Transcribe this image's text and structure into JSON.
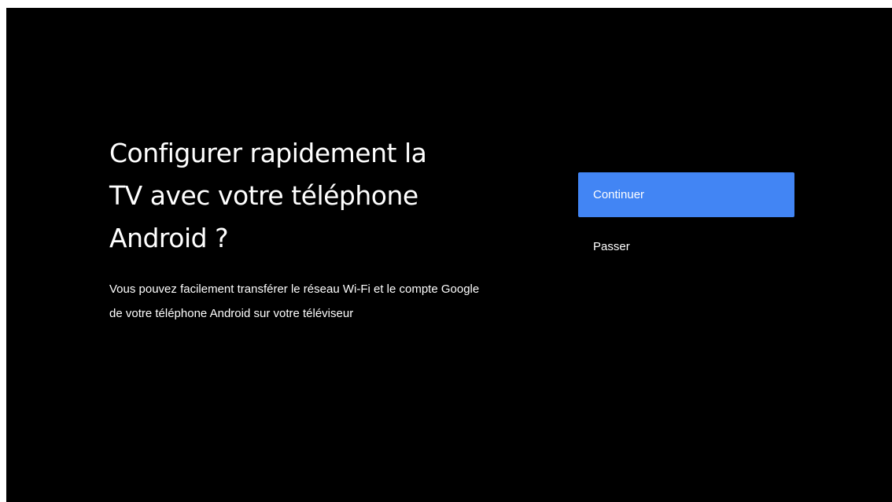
{
  "setup": {
    "title_line1": "Configurer rapidement la",
    "title_line2": "TV avec votre téléphone",
    "title_line3": "Android ?",
    "subtitle_line1": "Vous pouvez facilement transférer le réseau Wi-Fi et le compte Google",
    "subtitle_line2": "de votre téléphone Android sur votre téléviseur"
  },
  "actions": {
    "continue_label": "Continuer",
    "skip_label": "Passer"
  },
  "colors": {
    "background": "#000000",
    "focus_accent": "#4285f4",
    "text": "#ffffff"
  }
}
